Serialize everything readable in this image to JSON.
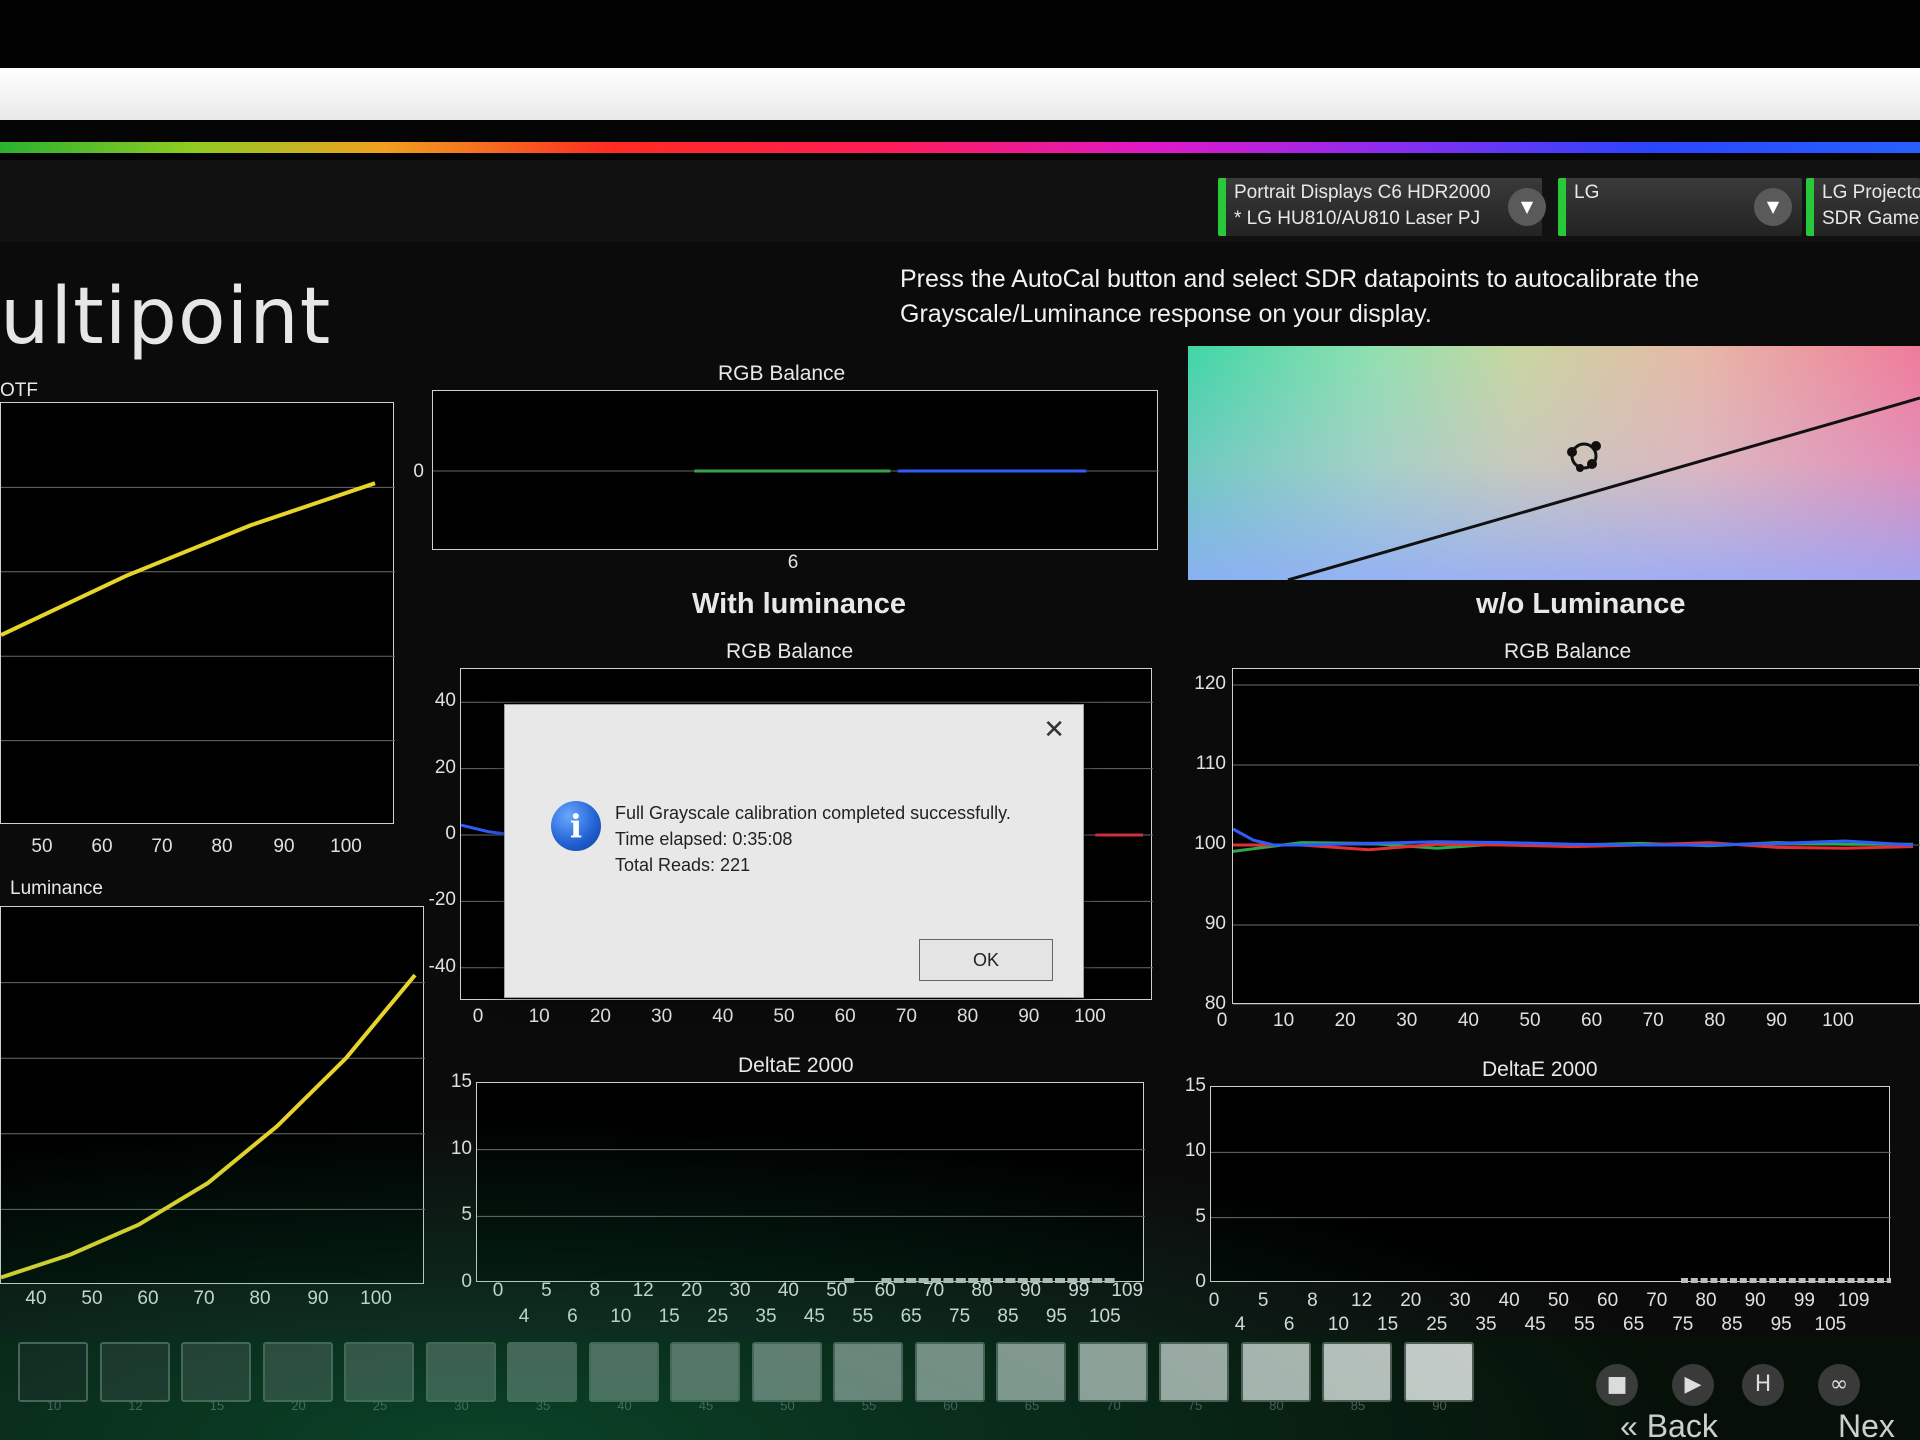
{
  "app": {
    "title": "ultipoint",
    "instruction": "Press the AutoCal button and select SDR datapoints to autocalibrate the Grayscale/Luminance response on your display.",
    "meter_selector": {
      "line1": "Portrait Displays C6 HDR2000",
      "line2": "* LG HU810/AU810 Laser PJ"
    },
    "brand_selector": {
      "line1": "LG"
    },
    "profile_selector": {
      "line1": "LG Projecto",
      "line2": "SDR Game"
    },
    "accent_color": "#28c83a"
  },
  "sections": {
    "with": "With luminance",
    "without": "w/o Luminance"
  },
  "panels": {
    "eotf_title": "OTF",
    "luminance_title": "Luminance",
    "rgb_top_title": "RGB Balance",
    "rgb_with_title": "RGB Balance",
    "rgb_without_title": "RGB Balance",
    "de_with_title": "DeltaE 2000",
    "de_without_title": "DeltaE 2000"
  },
  "dialog": {
    "close_icon": "close-icon",
    "info_icon": "info-icon",
    "info_glyph": "i",
    "line1": "Full Grayscale calibration completed successfully.",
    "line2": "Time elapsed: 0:35:08",
    "line3": "Total Reads: 221",
    "ok": "OK"
  },
  "chart_data": [
    {
      "name_in_ui": "OTF",
      "type": "line",
      "x_ticks": [
        "50",
        "60",
        "70",
        "80",
        "90",
        "100"
      ],
      "series": [
        {
          "color": "#e6d42a",
          "x": [
            40,
            50,
            60,
            70,
            80,
            90,
            100
          ],
          "y": [
            0.45,
            0.52,
            0.59,
            0.65,
            0.71,
            0.76,
            0.81
          ]
        }
      ]
    },
    {
      "name_in_ui": "Luminance",
      "type": "line",
      "x_ticks": [
        "40",
        "50",
        "60",
        "70",
        "80",
        "90",
        "100"
      ],
      "series": [
        {
          "color": "#e6d42a",
          "x": [
            40,
            50,
            60,
            70,
            80,
            90,
            100
          ],
          "y": [
            0.02,
            0.08,
            0.16,
            0.27,
            0.42,
            0.6,
            0.82
          ]
        }
      ]
    },
    {
      "name_in_ui": "RGB Balance (top)",
      "type": "line",
      "y_ticks": [
        "0"
      ],
      "x_ticks": [
        "6"
      ],
      "series": [
        {
          "color": "#3aa04a",
          "segment": [
            0.36,
            0.63
          ]
        },
        {
          "color": "#2d5cff",
          "segment": [
            0.64,
            0.9
          ]
        }
      ]
    },
    {
      "name_in_ui": "RGB Balance (with luminance)",
      "type": "line",
      "ylim": [
        -50,
        50
      ],
      "y_ticks": [
        "40",
        "20",
        "0",
        "-20",
        "-40"
      ],
      "x_ticks": [
        "0",
        "10",
        "20",
        "30",
        "40",
        "50",
        "60",
        "70",
        "80",
        "90",
        "100"
      ],
      "series": [
        {
          "color": "#2d5cff",
          "x": [
            0,
            4,
            8
          ],
          "y": [
            3,
            1,
            0
          ]
        },
        {
          "color": "#d0303c",
          "x": [
            93,
            100
          ],
          "y": [
            0,
            0
          ]
        }
      ]
    },
    {
      "name_in_ui": "RGB Balance (w/o luminance)",
      "type": "line",
      "ylim": [
        80,
        122
      ],
      "y_ticks": [
        "120",
        "110",
        "100",
        "90",
        "80"
      ],
      "x_ticks": [
        "0",
        "10",
        "20",
        "30",
        "40",
        "50",
        "60",
        "70",
        "80",
        "90",
        "100"
      ],
      "series": [
        {
          "color": "#2d5cff",
          "x": [
            0,
            3,
            6,
            10,
            20,
            30,
            40,
            50,
            60,
            70,
            80,
            90,
            100
          ],
          "y": [
            102,
            100.6,
            100,
            100,
            100.2,
            100.4,
            100.3,
            100.1,
            100,
            100,
            100.2,
            100.5,
            100
          ]
        },
        {
          "color": "#e03030",
          "x": [
            0,
            10,
            20,
            30,
            40,
            50,
            60,
            70,
            80,
            90,
            100
          ],
          "y": [
            100,
            100,
            99.4,
            100.1,
            100,
            99.8,
            100,
            100.3,
            99.7,
            99.6,
            99.8
          ]
        },
        {
          "color": "#2ea84a",
          "x": [
            0,
            10,
            20,
            30,
            40,
            50,
            60,
            70,
            80,
            90,
            100
          ],
          "y": [
            99.2,
            100.3,
            100.2,
            99.6,
            100.2,
            100,
            100.2,
            99.9,
            100.3,
            100.1,
            100.1
          ]
        }
      ]
    },
    {
      "name_in_ui": "DeltaE 2000 (with luminance)",
      "type": "bar",
      "ylim": [
        0,
        15
      ],
      "y_ticks": [
        "15",
        "10",
        "5",
        "0"
      ],
      "x_ticks_upper": [
        "0",
        "5",
        "8",
        "12",
        "20",
        "30",
        "40",
        "50",
        "60",
        "70",
        "80",
        "90",
        "99",
        "109"
      ],
      "x_ticks_lower": [
        "4",
        "6",
        "10",
        "15",
        "25",
        "35",
        "45",
        "55",
        "65",
        "75",
        "85",
        "95",
        "105"
      ]
    },
    {
      "name_in_ui": "DeltaE 2000 (w/o luminance)",
      "type": "bar",
      "ylim": [
        0,
        15
      ],
      "y_ticks": [
        "15",
        "10",
        "5",
        "0"
      ],
      "x_ticks_upper": [
        "0",
        "5",
        "8",
        "12",
        "20",
        "30",
        "40",
        "50",
        "60",
        "70",
        "80",
        "90",
        "99",
        "109"
      ],
      "x_ticks_lower": [
        "4",
        "6",
        "10",
        "15",
        "25",
        "35",
        "45",
        "55",
        "65",
        "75",
        "85",
        "95",
        "105"
      ]
    }
  ],
  "patches": {
    "labels": [
      "10",
      "12",
      "15",
      "20",
      "25",
      "30",
      "35",
      "40",
      "45",
      "50",
      "55",
      "60",
      "65",
      "70",
      "75",
      "80",
      "85",
      "90"
    ]
  },
  "toolbar": {
    "back": "Back",
    "next": "Nex",
    "stop_icon": "stop-icon",
    "play_icon": "play-icon",
    "hold_icon": "hold-icon",
    "loop_icon": "loop-icon"
  }
}
